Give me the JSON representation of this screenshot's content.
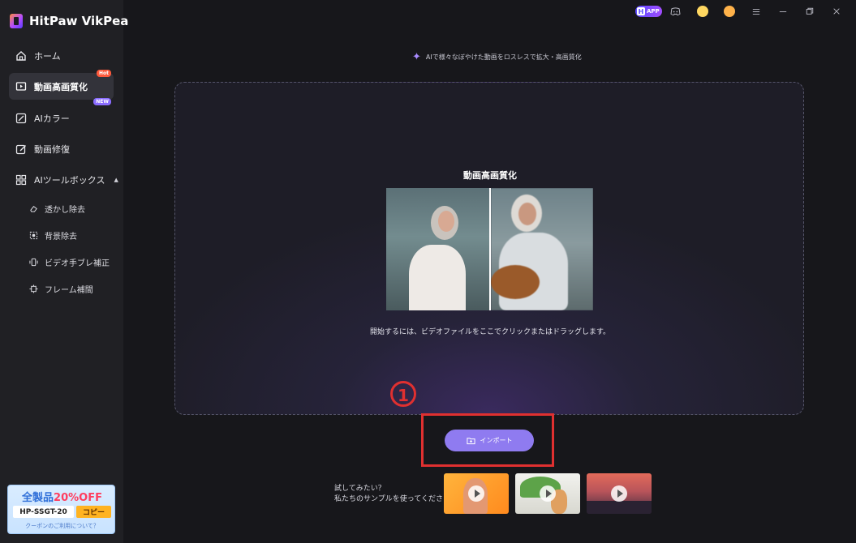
{
  "app": {
    "name": "HitPaw VikPea"
  },
  "sidebar": {
    "items": [
      {
        "label": "ホーム",
        "icon": "home-icon"
      },
      {
        "label": "動画高画質化",
        "icon": "video-enhance-icon",
        "badge": "Hot"
      },
      {
        "label": "AIカラー",
        "icon": "ai-color-icon",
        "badge": "NEW"
      },
      {
        "label": "動画修復",
        "icon": "video-repair-icon"
      },
      {
        "label": "AIツールボックス",
        "icon": "toolbox-icon"
      }
    ],
    "subitems": [
      {
        "label": "透かし除去",
        "icon": "eraser-icon"
      },
      {
        "label": "背景除去",
        "icon": "background-remove-icon"
      },
      {
        "label": "ビデオ手ブレ補正",
        "icon": "stabilize-icon"
      },
      {
        "label": "フレーム補間",
        "icon": "frame-interpolation-icon"
      }
    ]
  },
  "coupon": {
    "title_main": "全製品",
    "title_pct": "20%OFF",
    "code": "HP-SSGT-20",
    "copy_label": "コピー",
    "note": "クーポンのご利用について？"
  },
  "topbar": {
    "app_label": "APP"
  },
  "main": {
    "tagline": "AIで様々なぼやけた動画をロスレスで拡大・高画質化",
    "dropzone_title": "動画高画質化",
    "dropzone_hint": "開始するには、ビデオファイルをここでクリックまたはドラッグします。",
    "step_number": "1",
    "import_label": "インポート",
    "try_line1": "試してみたい？",
    "try_line2": "私たちのサンプルを使ってください"
  },
  "colors": {
    "accent": "#8f7bf0",
    "highlight": "#e03030",
    "hot_badge": "#ff5a3c",
    "new_badge": "#8a6cff"
  }
}
